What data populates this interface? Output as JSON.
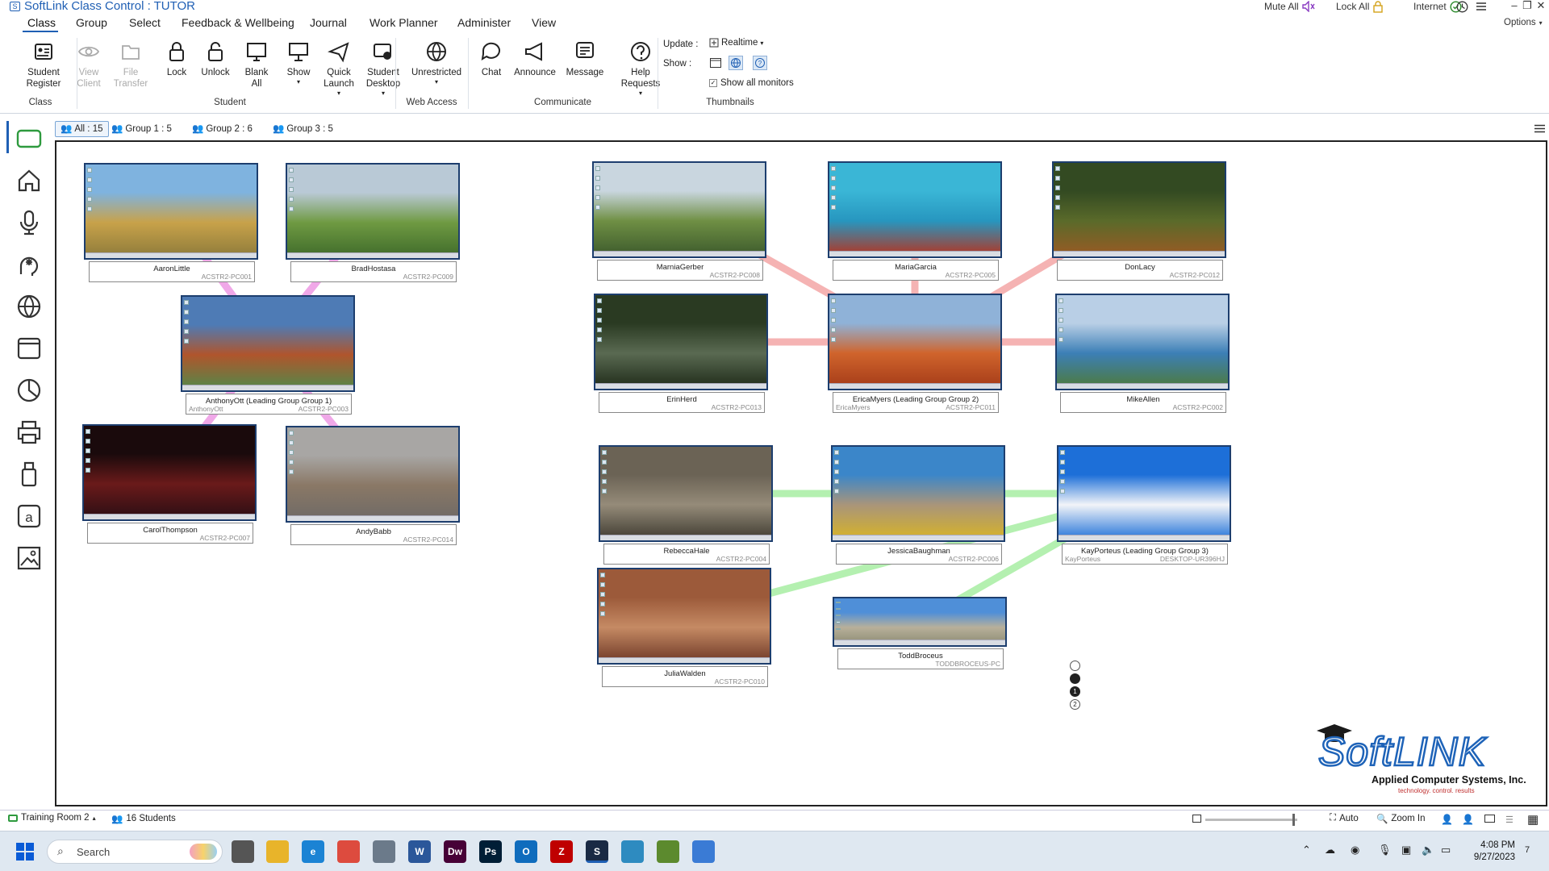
{
  "app": {
    "title": "SoftLink Class Control : TUTOR",
    "logo_letter": "S"
  },
  "title_right": {
    "mute_all": "Mute All",
    "lock_all": "Lock All",
    "internet": "Internet",
    "options": "Options"
  },
  "menu": [
    "Class",
    "Group",
    "Select",
    "Feedback & Wellbeing",
    "Journal",
    "Work Planner",
    "Administer",
    "View"
  ],
  "ribbon": {
    "buttons": [
      {
        "id": "student-register",
        "label": "Student\nRegister",
        "disabled": false
      },
      {
        "id": "view-client",
        "label": "View\nClient",
        "disabled": true
      },
      {
        "id": "file-transfer",
        "label": "File\nTransfer",
        "disabled": true
      },
      {
        "id": "lock",
        "label": "Lock",
        "disabled": false
      },
      {
        "id": "unlock",
        "label": "Unlock",
        "disabled": false
      },
      {
        "id": "blank-all",
        "label": "Blank\nAll",
        "disabled": false
      },
      {
        "id": "show",
        "label": "Show",
        "disabled": false
      },
      {
        "id": "quick-launch",
        "label": "Quick\nLaunch",
        "disabled": false
      },
      {
        "id": "student-desktop",
        "label": "Student\nDesktop",
        "disabled": false
      },
      {
        "id": "unrestricted",
        "label": "Unrestricted",
        "disabled": false
      },
      {
        "id": "chat",
        "label": "Chat",
        "disabled": false
      },
      {
        "id": "announce",
        "label": "Announce",
        "disabled": false
      },
      {
        "id": "message",
        "label": "Message",
        "disabled": false
      },
      {
        "id": "help-requests",
        "label": "Help\nRequests",
        "disabled": false
      }
    ],
    "groups": [
      "Class",
      "Student",
      "Web Access",
      "Communicate",
      "Thumbnails"
    ],
    "update_label": "Update :",
    "update_value": "Realtime",
    "show_label": "Show :",
    "show_all_monitors": "Show all monitors"
  },
  "tabs": [
    {
      "label": "All : 15",
      "active": true
    },
    {
      "label": "Group 1 : 5",
      "active": false
    },
    {
      "label": "Group 2 : 6",
      "active": false
    },
    {
      "label": "Group 3 : 5",
      "active": false
    }
  ],
  "students": [
    {
      "name": "AaronLittle",
      "pc": "ACSTR2-PC001",
      "alias": "",
      "c1": "#7fb3df",
      "c2": "#c8a24a",
      "c3": "#8c7a3a"
    },
    {
      "name": "BradHostasa",
      "pc": "ACSTR2-PC009",
      "alias": "",
      "c1": "#b9c9d6",
      "c2": "#6f9a42",
      "c3": "#3e6a2a"
    },
    {
      "name": "AnthonyOtt (Leading Group Group 1)",
      "pc": "ACSTR2-PC003",
      "alias": "AnthonyOtt",
      "c1": "#4e7bb5",
      "c2": "#b0552c",
      "c3": "#4f8a4a"
    },
    {
      "name": "CarolThompson",
      "pc": "ACSTR2-PC007",
      "alias": "",
      "c1": "#1a0a0c",
      "c2": "#6a1a1a",
      "c3": "#2a0e14"
    },
    {
      "name": "AndyBabb",
      "pc": "ACSTR2-PC014",
      "alias": "",
      "c1": "#a8a6a4",
      "c2": "#8a7866",
      "c3": "#6e6a66"
    },
    {
      "name": "MarniaGerber",
      "pc": "ACSTR2-PC008",
      "alias": "",
      "c1": "#c9d6df",
      "c2": "#6f8f44",
      "c3": "#3c5a2c"
    },
    {
      "name": "MariaGarcia",
      "pc": "ACSTR2-PC005",
      "alias": "",
      "c1": "#3ab6d6",
      "c2": "#2796bf",
      "c3": "#b8321e"
    },
    {
      "name": "DonLacy",
      "pc": "ACSTR2-PC012",
      "alias": "",
      "c1": "#334a22",
      "c2": "#5a6a2a",
      "c3": "#9a5a24"
    },
    {
      "name": "ErinHerd",
      "pc": "ACSTR2-PC013",
      "alias": "",
      "c1": "#2a3a22",
      "c2": "#5a6a52",
      "c3": "#1e2a18"
    },
    {
      "name": "EricaMyers (Leading Group Group 2)",
      "pc": "ACSTR2-PC011",
      "alias": "EricaMyers",
      "c1": "#8fb2d8",
      "c2": "#d0642c",
      "c3": "#a33a18"
    },
    {
      "name": "MikeAllen",
      "pc": "ACSTR2-PC002",
      "alias": "",
      "c1": "#b9cfe6",
      "c2": "#3c7fb6",
      "c3": "#4e7a38"
    },
    {
      "name": "RebeccaHale",
      "pc": "ACSTR2-PC004",
      "alias": "",
      "c1": "#6b6355",
      "c2": "#958b79",
      "c3": "#3e3a30"
    },
    {
      "name": "JessicaBaughman",
      "pc": "ACSTR2-PC006",
      "alias": "",
      "c1": "#3b86c9",
      "c2": "#a9957a",
      "c3": "#d8b425"
    },
    {
      "name": "KayPorteus (Leading Group Group 3)",
      "pc": "DESKTOP-UR396HJ",
      "alias": "KayPorteus",
      "c1": "#1d6fd8",
      "c2": "#f2f4f8",
      "c3": "#1d6fd8"
    },
    {
      "name": "JuliaWalden",
      "pc": "ACSTR2-PC010",
      "alias": "",
      "c1": "#9c5a3a",
      "c2": "#c58a64",
      "c3": "#6e3826"
    },
    {
      "name": "ToddBroceus",
      "pc": "TODDBROCEUS-PC",
      "alias": "",
      "c1": "#4f8fd8",
      "c2": "#b8b09a",
      "c3": "#8a8a72"
    }
  ],
  "brand": {
    "name": "SoftLINK",
    "company": "Applied Computer Systems, Inc.",
    "tagline": "technology. control. results"
  },
  "status": {
    "room": "Training Room 2",
    "students": "16 Students",
    "auto": "Auto",
    "zoom": "Zoom In"
  },
  "taskbar": {
    "search_placeholder": "Search",
    "time": "4:08 PM",
    "date": "9/27/2023",
    "notif": "7",
    "apps": [
      {
        "name": "task-view",
        "letter": "",
        "color": "#555"
      },
      {
        "name": "file-explorer",
        "letter": "",
        "color": "#e8b42a"
      },
      {
        "name": "edge",
        "letter": "e",
        "color": "#1b83d4"
      },
      {
        "name": "chrome",
        "letter": "",
        "color": "#dd4b3e"
      },
      {
        "name": "app-5",
        "letter": "",
        "color": "#6b7a8a"
      },
      {
        "name": "word",
        "letter": "W",
        "color": "#2b579a"
      },
      {
        "name": "dreamweaver",
        "letter": "Dw",
        "color": "#470137"
      },
      {
        "name": "photoshop",
        "letter": "Ps",
        "color": "#001e36"
      },
      {
        "name": "outlook",
        "letter": "O",
        "color": "#0f6cbd"
      },
      {
        "name": "filezilla",
        "letter": "Z",
        "color": "#bf0000"
      },
      {
        "name": "softlink",
        "letter": "S",
        "color": "#1a2a44"
      },
      {
        "name": "app-12",
        "letter": "",
        "color": "#2e8bc0"
      },
      {
        "name": "app-13",
        "letter": "",
        "color": "#5c8a2e"
      },
      {
        "name": "app-14",
        "letter": "",
        "color": "#3a7bd5"
      }
    ]
  },
  "colors": {
    "accent": "#1f5fb4",
    "group1": "#f0a8e8",
    "group2": "#f5b3b3",
    "group3": "#b4f0b0"
  }
}
